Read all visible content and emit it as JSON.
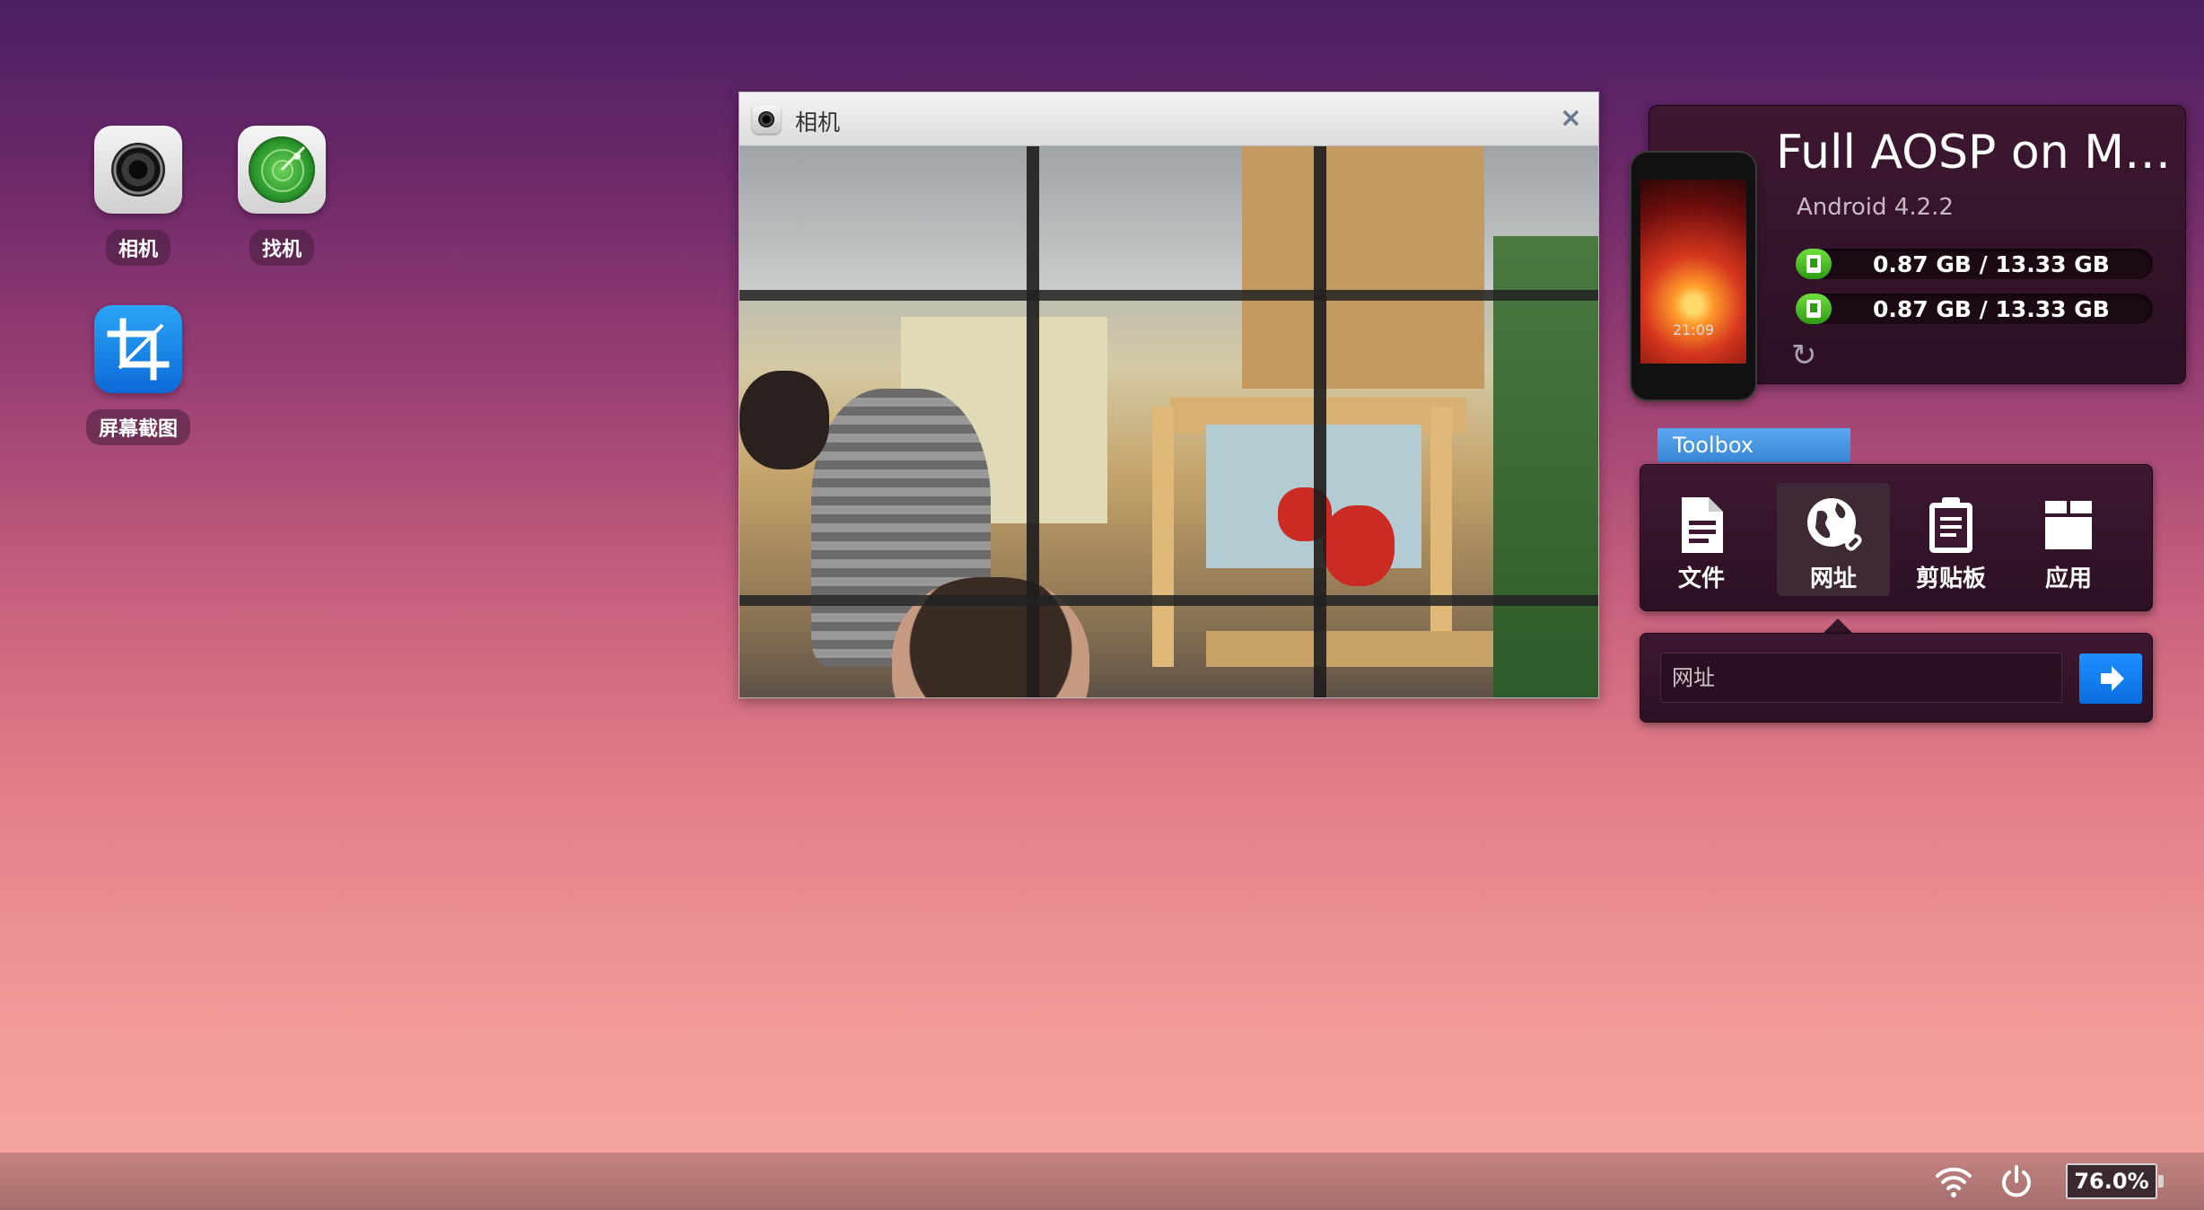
{
  "desktop": {
    "icons": [
      {
        "label": "相机",
        "icon": "camera-icon"
      },
      {
        "label": "找机",
        "icon": "radar-icon"
      },
      {
        "label": "屏幕截图",
        "icon": "crop-icon"
      }
    ]
  },
  "camera_window": {
    "title": "相机",
    "close_glyph": "×"
  },
  "device": {
    "name": "Full AOSP on M…",
    "os": "Android 4.2.2",
    "phone_clock": "21:09",
    "storage": [
      {
        "text": "0.87 GB / 13.33 GB",
        "used_fraction": 0.065
      },
      {
        "text": "0.87 GB / 13.33 GB",
        "used_fraction": 0.065
      }
    ],
    "refresh_glyph": "↻"
  },
  "toolbox": {
    "tab_label": "Toolbox",
    "items": [
      {
        "label": "文件",
        "icon": "file-icon"
      },
      {
        "label": "网址",
        "icon": "globe-link-icon",
        "active": true
      },
      {
        "label": "剪贴板",
        "icon": "clipboard-icon"
      },
      {
        "label": "应用",
        "icon": "app-box-icon"
      }
    ],
    "url_placeholder": "网址"
  },
  "taskbar": {
    "battery": "76.0%"
  },
  "colors": {
    "accent_blue": "#0a6ee0",
    "storage_green": "#2e9b14",
    "panel_bg": "#2c1024"
  }
}
